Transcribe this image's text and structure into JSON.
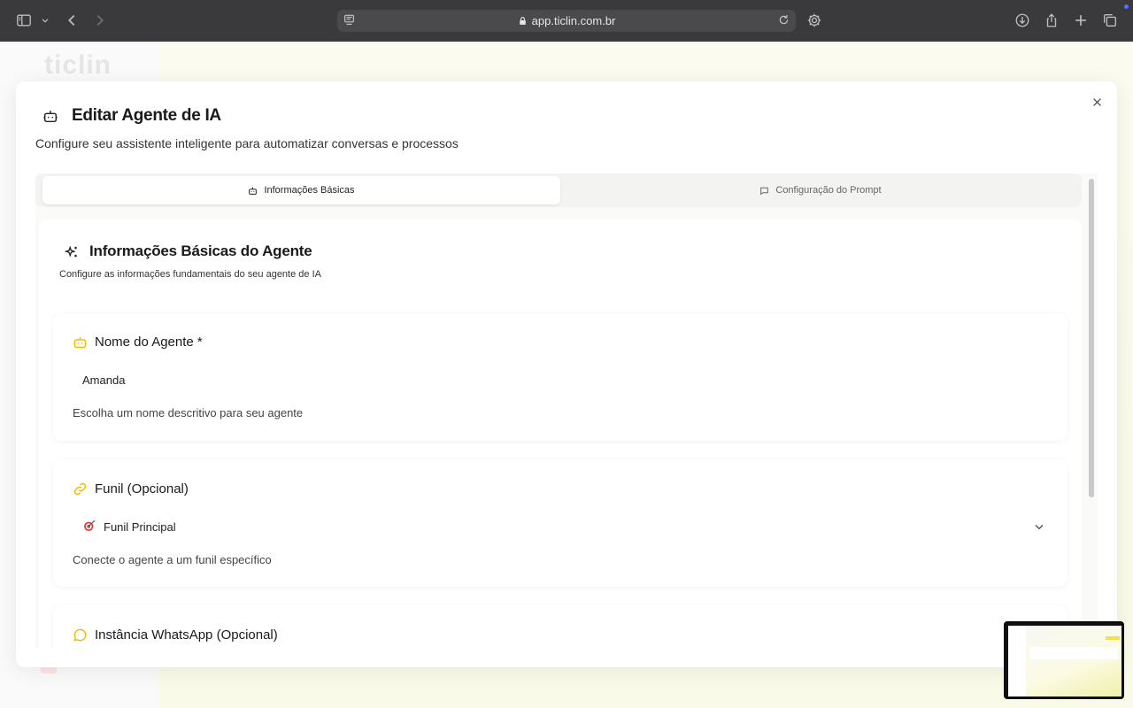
{
  "browser": {
    "url": "app.ticlin.com.br"
  },
  "background": {
    "logo_text": "ticlin"
  },
  "modal": {
    "title": "Editar Agente de IA",
    "subtitle": "Configure seu assistente inteligente para automatizar conversas e processos",
    "tabs": [
      {
        "label": "Informações Básicas",
        "icon": "bot-icon",
        "active": true
      },
      {
        "label": "Configuração do Prompt",
        "icon": "message-square-icon",
        "active": false
      }
    ],
    "section": {
      "title": "Informações Básicas do Agente",
      "subtitle": "Configure as informações fundamentais do seu agente de IA"
    },
    "fields": {
      "name": {
        "label": "Nome do Agente *",
        "value": "Amanda",
        "help": "Escolha um nome descritivo para seu agente"
      },
      "funnel": {
        "label": "Funil (Opcional)",
        "value": "Funil Principal",
        "help": "Conecte o agente a um funil específico"
      },
      "whatsapp": {
        "label": "Instância WhatsApp (Opcional)"
      }
    },
    "colors": {
      "accent": "#f5b800"
    }
  }
}
